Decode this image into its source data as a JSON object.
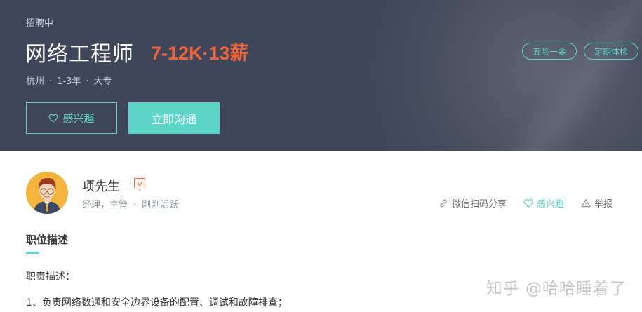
{
  "header": {
    "status": "招聘中",
    "job_title": "网络工程师",
    "salary": "7-12K·13薪",
    "city": "杭州",
    "experience": "1-3年",
    "education": "大专",
    "interest_button": "感兴趣",
    "chat_button": "立即沟通",
    "tags": [
      "五险一金",
      "定期体检"
    ]
  },
  "recruiter": {
    "name": "项先生",
    "badge": "V",
    "title": "经理，主管",
    "activity": "刚刚活跃"
  },
  "actions": {
    "share": "微信扫码分享",
    "interest": "感兴趣",
    "report": "举报"
  },
  "description": {
    "section_title": "职位描述",
    "label": "职责描述：",
    "lines": [
      "1、负责网络数通和安全边界设备的配置、调试和故障排查；"
    ]
  },
  "watermark": "知乎 @哈哈睡着了",
  "colors": {
    "banner": "#3f4659",
    "accent": "#5dd5c8",
    "salary": "#f0643a"
  },
  "icons": [
    "heart-icon",
    "link-icon",
    "warning-icon",
    "verified-badge-icon"
  ]
}
